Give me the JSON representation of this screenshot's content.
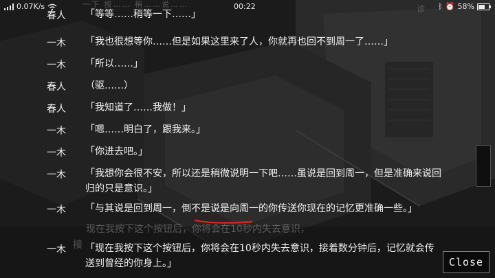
{
  "status_bar": {
    "network_speed": "0.07K/s",
    "time": "00:22",
    "battery": "58%"
  },
  "background_fragments": {
    "top_text": "一下  按…… 稍……说……",
    "top_right": "诊"
  },
  "dialogue": [
    {
      "speaker": "春人",
      "text": "「等等……稍等一下……」"
    },
    {
      "speaker": "一木",
      "text": "「我也很想等你……但是如果这里来了人，你就再也回不到周一了……」"
    },
    {
      "speaker": "一木",
      "text": "「所以……」"
    },
    {
      "speaker": "春人",
      "text": "（驱……）"
    },
    {
      "speaker": "春人",
      "text": "「我知道了……我做！」"
    },
    {
      "speaker": "一木",
      "text": "「嗯……明白了，跟我来。」"
    },
    {
      "speaker": "一木",
      "text": "「你进去吧。」"
    },
    {
      "speaker": "一木",
      "text": "「我想你会很不安，所以还是稍微说明一下吧……虽说是回到周一，但是准确来说回归的只是意识。」"
    },
    {
      "speaker": "一木",
      "text": "「与其说是回到周一，倒不是说是向周一的你传送你现在的记忆更准确一些。」"
    },
    {
      "speaker": "一木",
      "text": "「现在我按下这个按钮后，你将会在10秒内失去意识，接着数分钟后，记忆就会传送到曾经的你身上。」"
    }
  ],
  "ghost_text": {
    "line1": "现在我按下这个按钮后，你将会在10秒内失去意识，",
    "line2": "接"
  },
  "close_button": {
    "label": "Close"
  },
  "colors": {
    "underline": "#d8241c",
    "text": "#f2f2f2",
    "background": "#1b1b1b"
  }
}
